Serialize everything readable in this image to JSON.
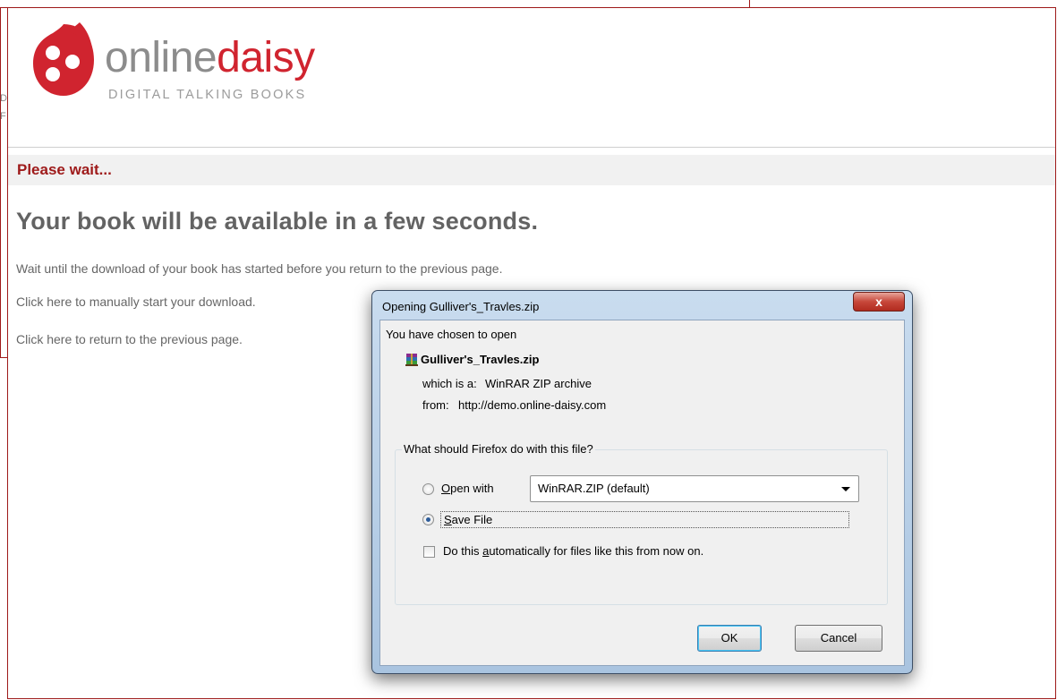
{
  "background": {
    "letters": [
      "D",
      "F"
    ]
  },
  "brand": {
    "name_part1": "online",
    "name_part2": "daisy",
    "tagline": "DIGITAL TALKING BOOKS"
  },
  "page": {
    "wait_title": "Please wait...",
    "headline": "Your book will be available in a few seconds.",
    "instruction": "Wait until the download of your book has started before you return to the previous page.",
    "manual_link": "Click here to manually start your download.",
    "back_link": "Click here to return to the previous page."
  },
  "dialog": {
    "title": "Opening Gulliver's_Travles.zip",
    "close_glyph": "x",
    "chosen_text": "You have chosen to open",
    "file_name": "Gulliver's_Travles.zip",
    "file_icon": "winrar-archive-icon",
    "which_label": "which is a:",
    "which_value": "WinRAR ZIP archive",
    "from_label": "from:",
    "from_value": "http://demo.online-daisy.com",
    "group_title": "What should Firefox do with this file?",
    "open_with_prefix": "",
    "open_with_accel": "O",
    "open_with_rest": "pen with",
    "open_with_app": "WinRAR.ZIP (default)",
    "save_accel": "S",
    "save_rest": "ave File",
    "selected_option": "save",
    "auto_pre": "Do this ",
    "auto_accel": "a",
    "auto_post": "utomatically for files like this from now on.",
    "auto_checked": false,
    "ok_label": "OK",
    "cancel_label": "Cancel"
  },
  "colors": {
    "brand_red": "#d0242f",
    "dark_red": "#9e1a1a",
    "brand_gray": "#8c8c8c"
  }
}
